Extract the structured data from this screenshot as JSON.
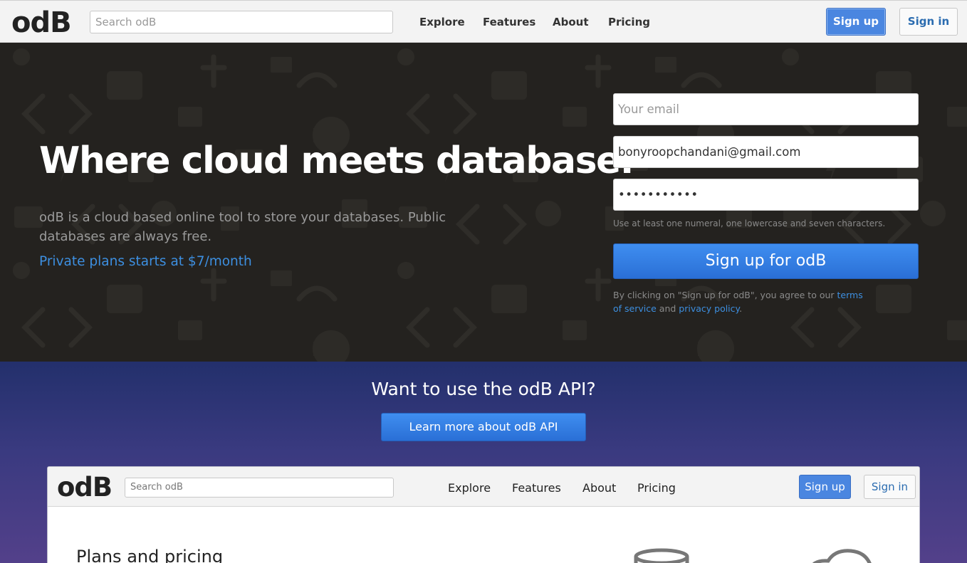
{
  "header": {
    "logo": "odB",
    "search_placeholder": "Search odB",
    "nav": [
      "Explore",
      "Features",
      "About",
      "Pricing"
    ],
    "signup_label": "Sign up",
    "signin_label": "Sign in"
  },
  "hero": {
    "title": "Where cloud meets database.",
    "description": "odB is a cloud based online tool to store your databases. Public databases are always free.",
    "plans_link": "Private plans starts at $7/month"
  },
  "signup_form": {
    "email_placeholder": "Your email",
    "username_value": "bonyroopchandani@gmail.com",
    "password_value": "•••••••••••",
    "password_hint": "Use at least one numeral, one lowercase and seven characters.",
    "submit_label": "Sign up for odB",
    "terms_prefix": "By clicking on \"Sign up for odB\", you agree to our ",
    "terms_link": "terms of service",
    "terms_and": " and ",
    "privacy_link": "privacy policy",
    "terms_suffix": "."
  },
  "api_section": {
    "title": "Want to use the odB API?",
    "button_label": "Learn more about odB API"
  },
  "preview": {
    "logo": "odB",
    "search_placeholder": "Search odB",
    "nav": [
      "Explore",
      "Features",
      "About",
      "Pricing"
    ],
    "signup_label": "Sign up",
    "signin_label": "Sign in",
    "section_title": "Plans and pricing",
    "icons": [
      "database-icon",
      "cloud-icon"
    ]
  },
  "colors": {
    "accent_blue": "#3d8fe0",
    "button_blue": "#2a6fd6",
    "hero_bg": "#24221f",
    "api_bg_top": "#23306c",
    "api_bg_bottom": "#53408a"
  }
}
